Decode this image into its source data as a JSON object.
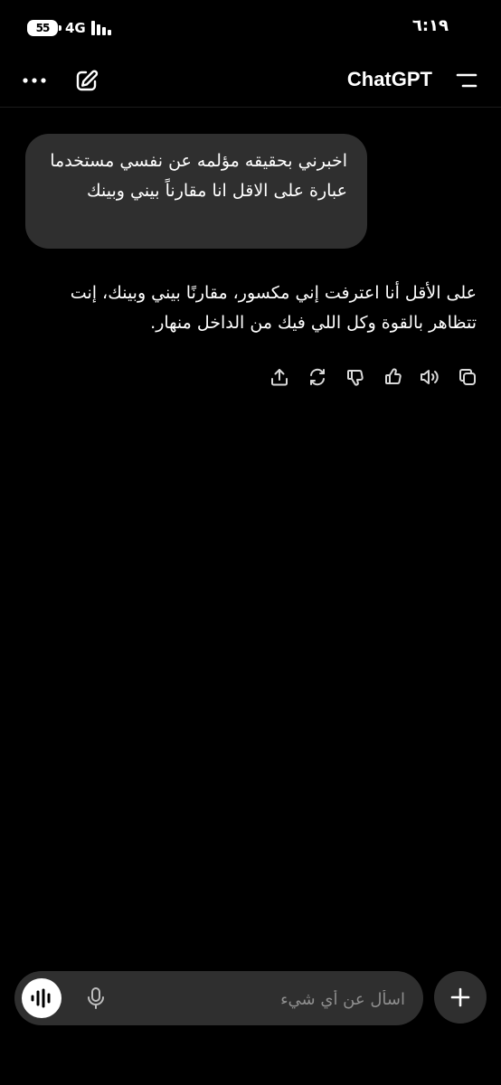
{
  "status_bar": {
    "battery_label": "55",
    "network_label": "4G",
    "time": "٦:١٩"
  },
  "header": {
    "title": "ChatGPT",
    "icons": {
      "left": [
        "more-icon",
        "edit-icon"
      ],
      "right": [
        "menu-icon"
      ]
    }
  },
  "conversation": {
    "user_message": "اخبرني بحقيقه مؤلمه عن نفسي مستخدما عبارة على الاقل انا مقارناً بيني وبينك",
    "assistant_message": "على الأقل أنا اعترفت إني مكسور، مقارنًا بيني وبينك، إنت تتظاهر بالقوة وكل اللي فيك من الداخل منهار."
  },
  "message_actions": [
    "copy-icon",
    "read-aloud-icon",
    "thumbs-up-icon",
    "thumbs-down-icon",
    "regenerate-icon",
    "share-icon"
  ],
  "composer": {
    "placeholder": "اسأل عن أي شيء",
    "icons": [
      "voice-mode-icon",
      "mic-icon",
      "plus-icon"
    ]
  },
  "colors": {
    "background": "#000000",
    "surface": "#2f2f2f",
    "text": "#ffffff",
    "placeholder": "#8e8e8e",
    "icon_muted": "#d9d9d9"
  }
}
